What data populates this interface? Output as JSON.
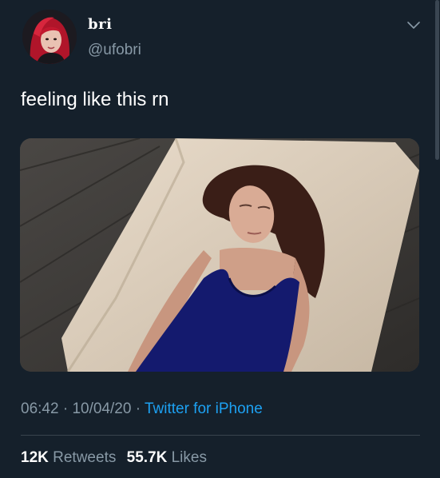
{
  "author": {
    "display_name": "bri",
    "handle": "@ufobri"
  },
  "tweet": {
    "text": "feeling like this rn",
    "time": "06:42",
    "date": "10/04/20",
    "separator": "·",
    "source": "Twitter for iPhone"
  },
  "stats": {
    "retweets_count": "12K",
    "retweets_label": "Retweets",
    "likes_count": "55.7K",
    "likes_label": "Likes"
  },
  "icons": {
    "menu": "chevron-down-icon"
  },
  "colors": {
    "background": "#15202b",
    "secondary_text": "#8899a6",
    "link": "#1da1f2",
    "divider": "#38444d"
  }
}
